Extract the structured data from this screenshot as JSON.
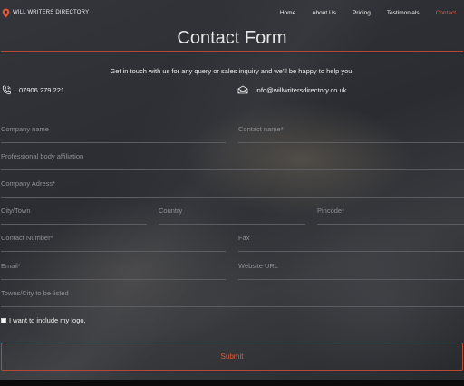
{
  "nav": {
    "brand": "WILL WRITERS DIRECTORY",
    "items": [
      {
        "label": "Home",
        "active": false
      },
      {
        "label": "About Us",
        "active": false
      },
      {
        "label": "Pricing",
        "active": false
      },
      {
        "label": "Testimonials",
        "active": false
      },
      {
        "label": "Contact",
        "active": true
      }
    ]
  },
  "page": {
    "title": "Contact Form",
    "intro": "Get in touch with us for any query or sales inquiry and we'll be happy to help you."
  },
  "contact": {
    "phone": "07906 279 221",
    "email": "info@willwritersdirectory.co.uk"
  },
  "form": {
    "company_name": "Company name",
    "contact_name": "Contact name*",
    "body_affiliation": "Professional body affiliation",
    "company_address": "Company Adress*",
    "city": "City/Town",
    "country": "Country",
    "pincode": "Pincode*",
    "contact_number": "Contact Number*",
    "fax": "Fax",
    "email": "Email*",
    "website": "Website URL",
    "towns_listed": "Towns/City to be listed",
    "logo_checkbox": "I want to include my logo.",
    "submit": "Submit"
  },
  "colors": {
    "accent": "#e05a3c",
    "rule": "#b24a33"
  }
}
